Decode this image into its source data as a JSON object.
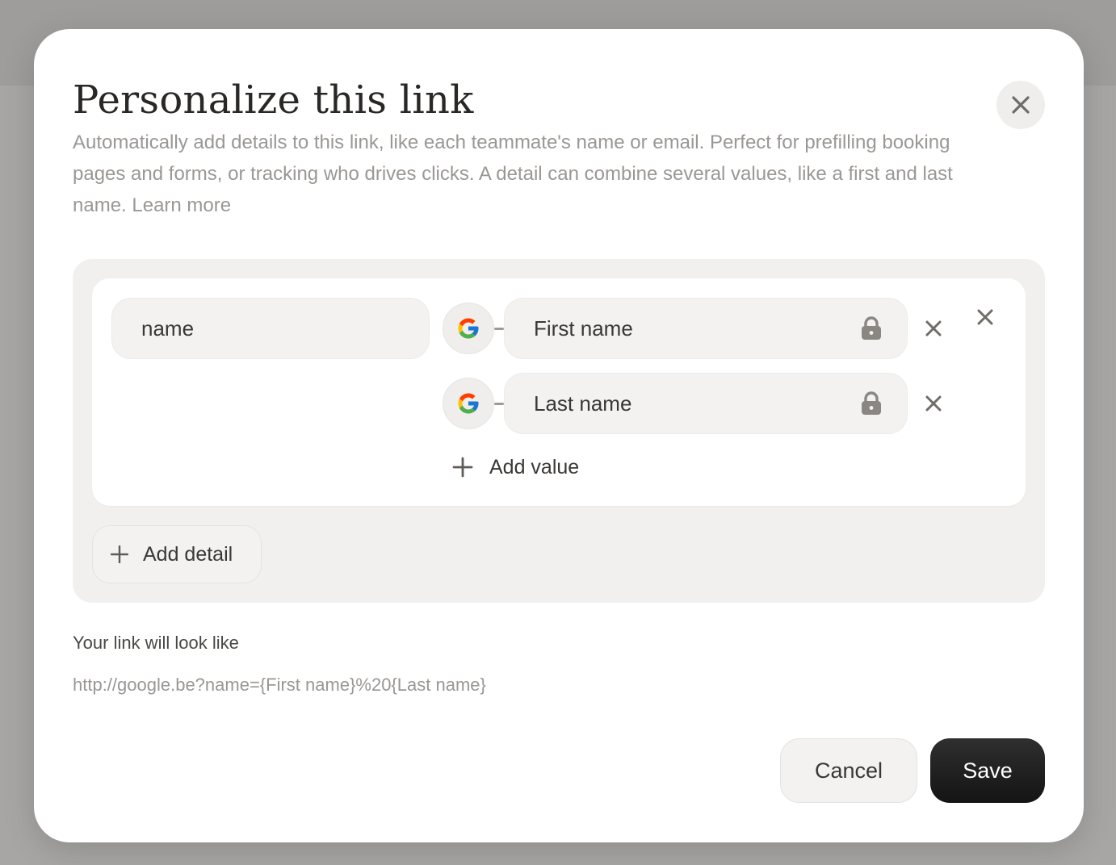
{
  "modal": {
    "title": "Personalize this link",
    "description": "Automatically add details to this link, like each teammate's name or email. Perfect for prefilling booking pages and forms, or tracking who drives clicks. A detail can combine several values, like a first and last name.",
    "learn_more": "Learn more"
  },
  "detail": {
    "name_value": "name",
    "values": [
      {
        "label": "First name",
        "source_icon": "google-icon",
        "locked": true
      },
      {
        "label": "Last name",
        "source_icon": "google-icon",
        "locked": true
      }
    ],
    "add_value_label": "Add value"
  },
  "add_detail_label": "Add detail",
  "preview": {
    "title": "Your link will look like",
    "url": "http://google.be?name={First name}%20{Last name}"
  },
  "actions": {
    "cancel_label": "Cancel",
    "save_label": "Save"
  },
  "colors": {
    "save_button_bg": "#1f1f1f",
    "panel_bg": "#f1f0ee",
    "muted_text": "#9a9794"
  }
}
